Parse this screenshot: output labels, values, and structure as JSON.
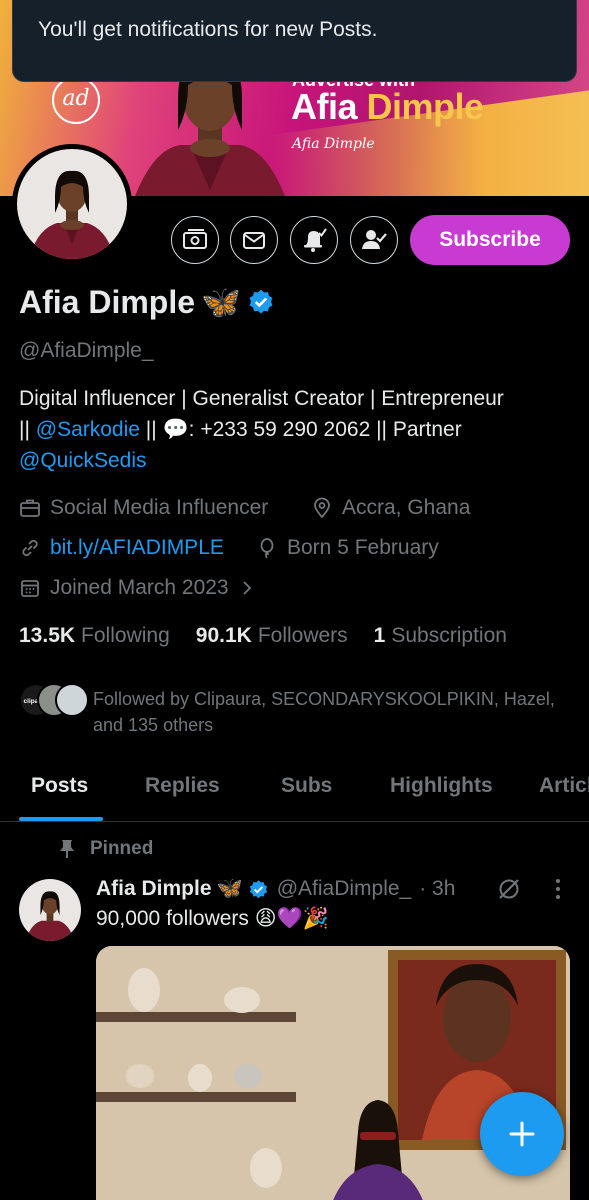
{
  "toast": {
    "message": "You'll get notifications for new Posts."
  },
  "banner": {
    "logo_text": "ad",
    "advertise_text": "Advertise with",
    "brand_first": "Afia",
    "brand_second": "Dimple",
    "signature": "Afia Dimple"
  },
  "profile": {
    "name": "Afia Dimple",
    "name_emoji": "🦋",
    "handle": "@AfiaDimple_",
    "subscribe_label": "Subscribe",
    "bio_line1": "Digital Influencer | Generalist Creator | Entrepreneur",
    "bio_sep1": "|| ",
    "bio_mention1": "@Sarkodie",
    "bio_sep2": " || 💬: +233 59 290 2062 || Partner",
    "bio_mention2": "@QuickSedis",
    "category": "Social Media Influencer",
    "location": "Accra, Ghana",
    "website": "bit.ly/AFIADIMPLE",
    "birthday": "Born 5 February",
    "joined": "Joined March 2023",
    "following_count": "13.5K",
    "following_label": "Following",
    "followers_count": "90.1K",
    "followers_label": "Followers",
    "subscriptions_count": "1",
    "subscriptions_label": "Subscription",
    "followed_by": "Followed by Clipaura, SECONDARYSKOOLPIKIN, Hazel, and 135 others",
    "follower_avatar_label": "clipaura"
  },
  "tabs": [
    {
      "label": "Posts"
    },
    {
      "label": "Replies"
    },
    {
      "label": "Subs"
    },
    {
      "label": "Highlights"
    },
    {
      "label": "Articles"
    }
  ],
  "post": {
    "pinned_label": "Pinned",
    "author_name": "Afia Dimple",
    "author_emoji": "🦋",
    "author_handle": "@AfiaDimple_",
    "time": "· 3h",
    "text": "90,000 followers 😩💜🎉"
  },
  "colors": {
    "accent": "#1d9bf0",
    "subscribe": "#c83bd3",
    "background": "#000000",
    "muted": "#71767b"
  }
}
